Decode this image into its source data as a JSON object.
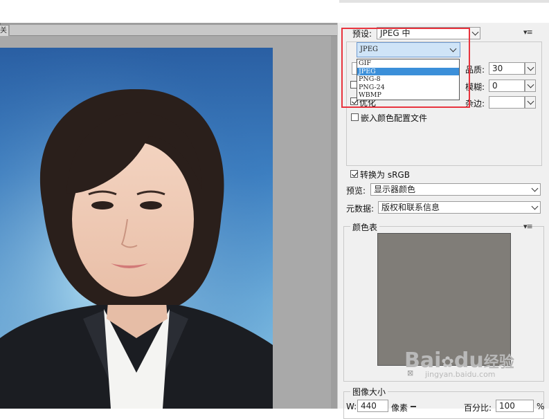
{
  "preview": {
    "tab_label": "关"
  },
  "settings": {
    "preset_label": "预设:",
    "preset_value": "JPEG 中",
    "format_value": "JPEG",
    "format_options": [
      "GIF",
      "JPEG",
      "PNG-8",
      "PNG-24",
      "WBMP"
    ],
    "format_selected_index": 1,
    "quality_label": "品质:",
    "quality_value": "30",
    "blur_label": "模糊:",
    "blur_value": "0",
    "matte_label": "杂边:",
    "matte_value": "",
    "optimize_label": "优化",
    "optimize_checked": true,
    "progressive_checked": false,
    "embed_profile_label": "嵌入颜色配置文件",
    "embed_profile_checked": false,
    "convert_srgb_label": "转换为 sRGB",
    "convert_srgb_checked": true,
    "preview_label": "预览:",
    "preview_value": "显示器颜色",
    "metadata_label": "元数据:",
    "metadata_value": "版权和联系信息"
  },
  "color_table": {
    "title": "颜色表",
    "swatch_color": "#807d78"
  },
  "image_size": {
    "title": "图像大小",
    "width_label": "W:",
    "width_value": "440",
    "width_unit": "像素",
    "percent_label": "百分比:",
    "percent_value": "100",
    "percent_unit": "%"
  },
  "watermark": {
    "brand": "Bai",
    "brand_tail": "du",
    "brand_cn": "经验",
    "url": "jingyan.baidu.com"
  },
  "colors": {
    "highlight": "#e8333d",
    "selection": "#3b8fd9"
  }
}
